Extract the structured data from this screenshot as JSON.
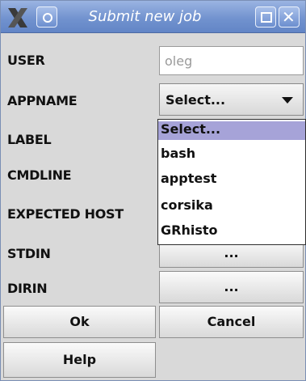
{
  "window": {
    "title": "Submit new job",
    "close_glyph": "✕",
    "icons": [
      "x-logo-icon",
      "window-menu-icon",
      "maximize-icon",
      "close-icon"
    ]
  },
  "form": {
    "user_label": "USER",
    "user_value": "oleg",
    "appname_label": "APPNAME",
    "appname_value": "Select...",
    "label_label": "LABEL",
    "cmdline_label": "CMDLINE",
    "expected_host_label": "EXPECTED HOST",
    "stdin_label": "STDIN",
    "stdin_button": "...",
    "dirin_label": "DIRIN",
    "dirin_button": "..."
  },
  "dropdown": {
    "options": [
      "Select...",
      "bash",
      "apptest",
      "corsika",
      "GRhisto"
    ],
    "selected": "Select..."
  },
  "buttons": {
    "ok": "Ok",
    "cancel": "Cancel",
    "help": "Help"
  },
  "colors": {
    "titlebar": "#7293cf",
    "selected_option": "#a6a3d8",
    "window_bg": "#d9d9d9"
  }
}
